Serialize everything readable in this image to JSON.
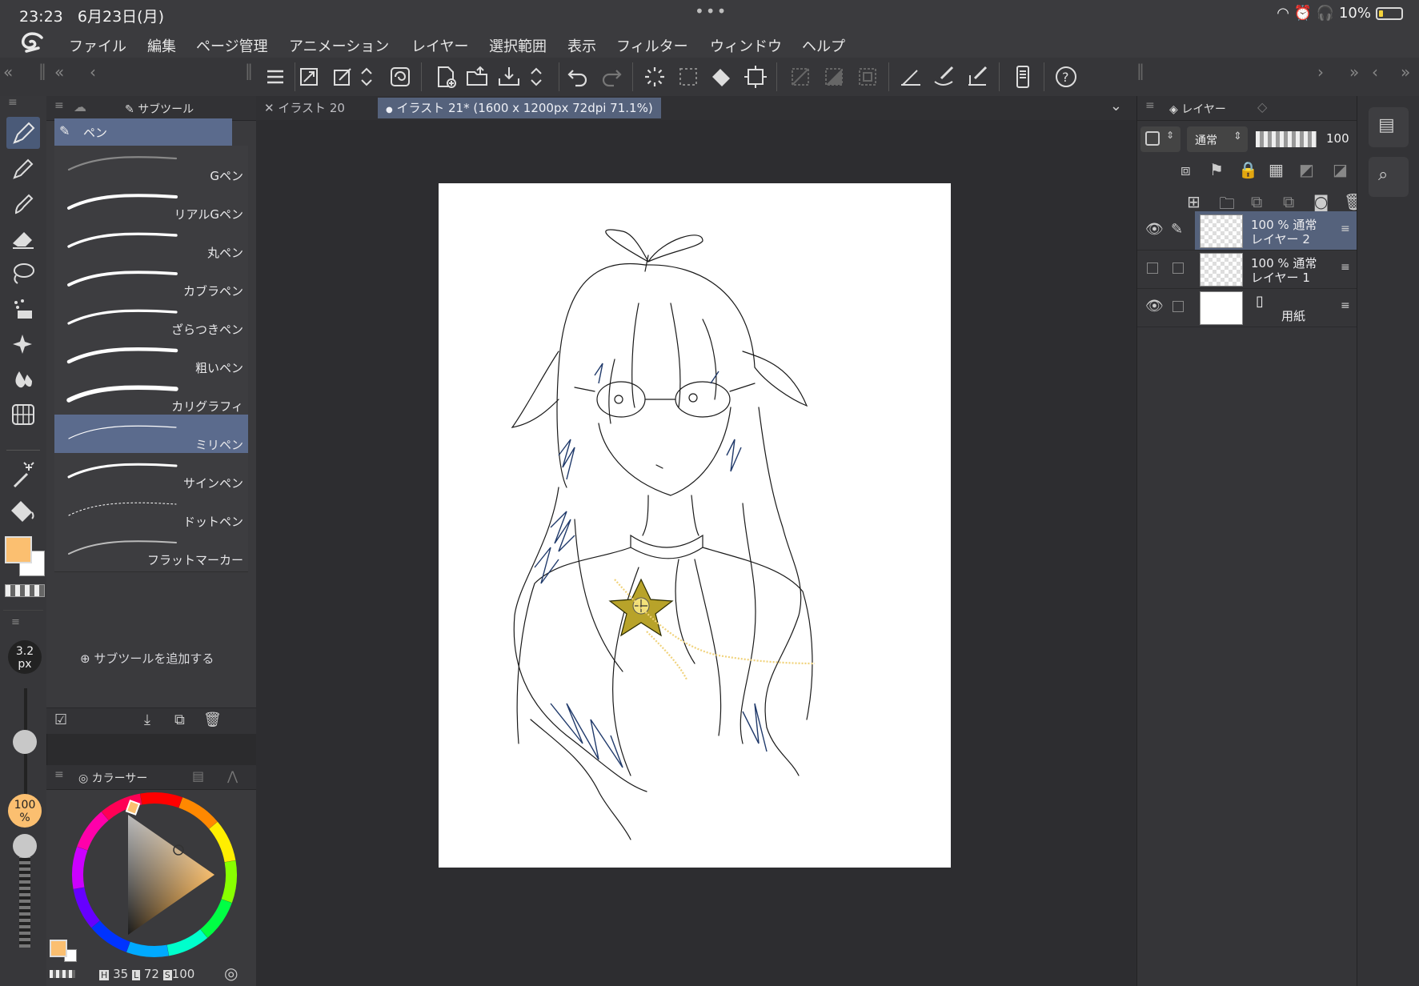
{
  "status": {
    "time": "23:23",
    "date": "6月23日(月)",
    "dots": "•••",
    "battery": "10%"
  },
  "menu": [
    "ファイル",
    "編集",
    "ページ管理",
    "アニメーション",
    "レイヤー",
    "選択範囲",
    "表示",
    "フィルター",
    "ウィンドウ",
    "ヘルプ"
  ],
  "subtool": {
    "tab_label": "サブツール",
    "group": "ペン",
    "brushes": [
      "Gペン",
      "リアルGペン",
      "丸ペン",
      "カブラペン",
      "ざらつきペン",
      "粗いペン",
      "カリグラフィ",
      "ミリペン",
      "サインペン",
      "ドットペン",
      "フラットマーカー"
    ],
    "selected_index": 7,
    "add_label": "サブツールを追加する"
  },
  "brush_size": {
    "value": "3.2",
    "unit": "px"
  },
  "opacity": {
    "value": "100",
    "unit": "%"
  },
  "color": {
    "tab_label": "カラーサー",
    "h": "35",
    "l": "72",
    "s": "100",
    "h_label": "H",
    "l_label": "L",
    "s_label": "S",
    "main": "#fbbf70",
    "sub": "#ffffff"
  },
  "tabs": [
    {
      "label": "イラスト 20",
      "prefix": "✕"
    },
    {
      "label": "イラスト 21* (1600 x 1200px 72dpi 71.1%)",
      "prefix": "●"
    }
  ],
  "layers": {
    "tab_label": "レイヤー",
    "blend": "通常",
    "opacity": "100",
    "items": [
      {
        "opacity": "100 % 通常",
        "name": "レイヤー 2",
        "selected": true
      },
      {
        "opacity": "100 % 通常",
        "name": "レイヤー 1",
        "selected": false
      },
      {
        "opacity": "",
        "name": "用紙",
        "selected": false
      }
    ]
  }
}
